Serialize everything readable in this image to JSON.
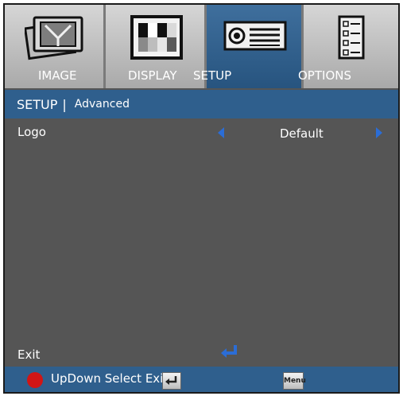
{
  "tabs": [
    {
      "label": "IMAGE",
      "icon": "image-photo-icon",
      "active": false
    },
    {
      "label": "DISPLAY",
      "icon": "display-pattern-icon",
      "active": false
    },
    {
      "label": "SETUP",
      "icon": "projector-icon",
      "active": true
    },
    {
      "label": "OPTIONS",
      "icon": "checklist-icon",
      "active": false
    }
  ],
  "breadcrumb": {
    "section": "SETUP",
    "separator": "|",
    "page": "Advanced"
  },
  "rows": {
    "logo": {
      "label": "Logo",
      "value": "Default"
    },
    "exit": {
      "label": "Exit"
    }
  },
  "footer": {
    "text": "UpDown Select Exit",
    "menu_key": "Menu"
  },
  "colors": {
    "accent": "#2f5f8d",
    "panel": "#555555",
    "arrow": "#2b6dd6",
    "exit_dot": "#d11515"
  }
}
